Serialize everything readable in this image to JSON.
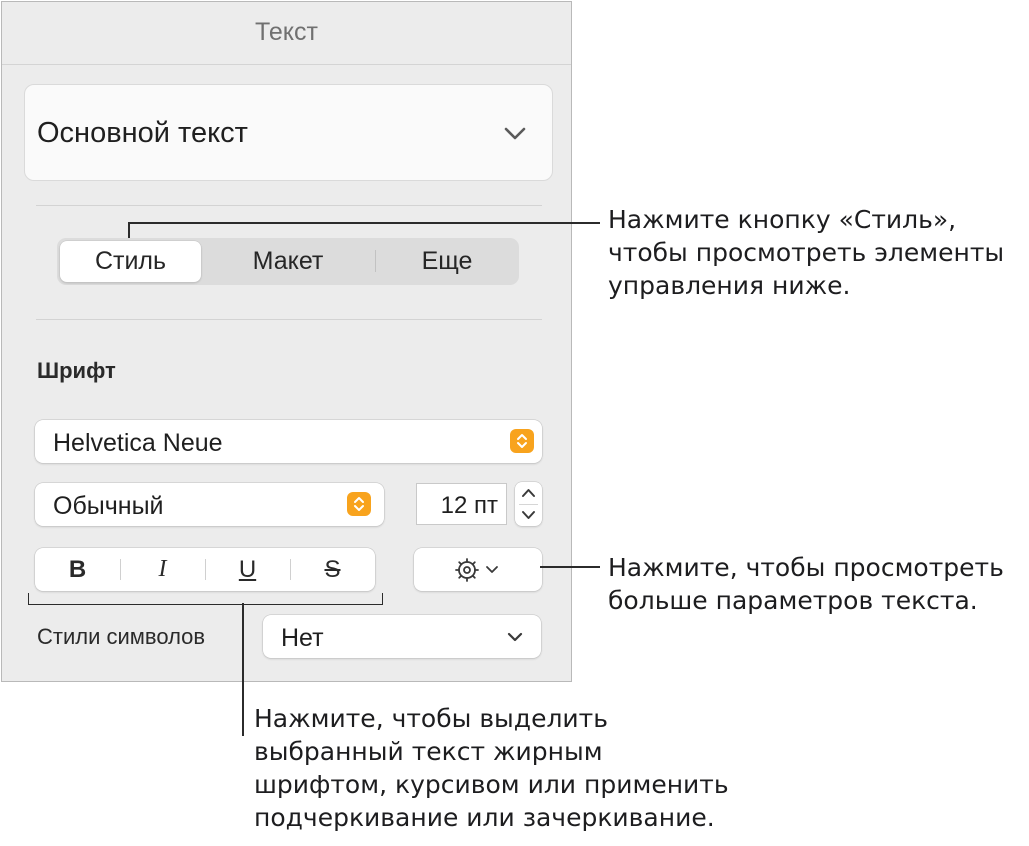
{
  "panel": {
    "title": "Текст",
    "paragraph_style": "Основной текст",
    "tabs": [
      "Стиль",
      "Макет",
      "Еще"
    ],
    "active_tab": "Стиль",
    "font_section_title": "Шрифт",
    "font_family": "Helvetica Neue",
    "font_typeface": "Обычный",
    "font_size": "12 пт",
    "format_buttons": {
      "bold": "B",
      "italic": "I",
      "underline": "U",
      "strikethrough": "S"
    },
    "character_styles_label": "Стили символов",
    "character_style_value": "Нет"
  },
  "callouts": {
    "style_tab": [
      "Нажмите кнопку «Стиль»,",
      "чтобы просмотреть элементы",
      "управления ниже."
    ],
    "gear": [
      "Нажмите, чтобы просмотреть",
      "больше параметров текста."
    ],
    "format": [
      "Нажмите, чтобы выделить",
      "выбранный текст жирным",
      "шрифтом, курсивом или применить",
      "подчеркивание или зачеркивание."
    ]
  },
  "colors": {
    "accent_stepper": "#f8a31d",
    "panel_bg": "#ececec"
  },
  "icons": [
    "chevron-down-icon",
    "updown-arrows-icon",
    "gear-icon"
  ]
}
